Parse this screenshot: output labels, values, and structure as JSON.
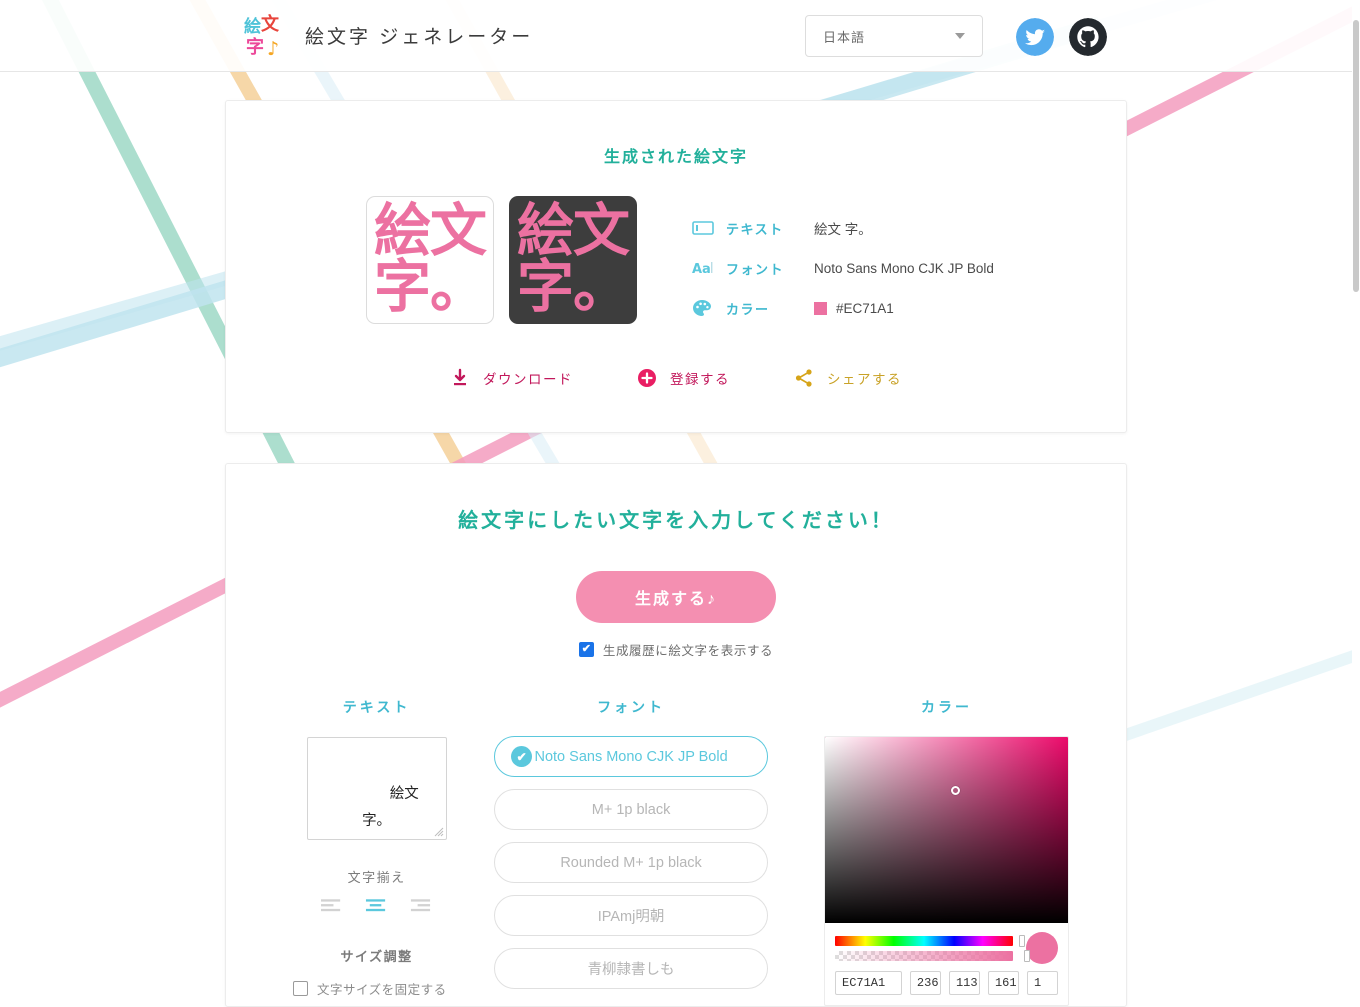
{
  "header": {
    "logo_name": "emoji-gen-logo",
    "title": "絵文字 ジェネレーター",
    "language": {
      "value": "日本語",
      "caret": "chevron-down-icon"
    },
    "social": [
      {
        "name": "twitter",
        "color": "#55ACEE"
      },
      {
        "name": "github",
        "color": "#24292E"
      }
    ]
  },
  "result": {
    "title": "生成された絵文字",
    "preview_text": "絵文\n字。",
    "preview_color": "#EC71A1",
    "dark_bg": "#3D3D3D",
    "meta": [
      {
        "icon": "text-field-icon",
        "label": "テキスト",
        "value": "絵文 字。"
      },
      {
        "icon": "font-aa-icon",
        "label": "フォント",
        "value": "Noto Sans Mono CJK JP Bold"
      },
      {
        "icon": "palette-icon",
        "label": "カラー",
        "value": "#EC71A1",
        "swatch": "#EC71A1"
      }
    ],
    "actions": [
      {
        "icon": "download-icon",
        "label": "ダウンロード",
        "color": "#C2185B"
      },
      {
        "icon": "plus-circle-icon",
        "label": "登録する",
        "color": "#C2185B"
      },
      {
        "icon": "share-icon",
        "label": "シェアする",
        "color": "#C9A227"
      }
    ]
  },
  "input": {
    "title": "絵文字にしたい文字を入力してください！",
    "generate_label": "生成する♪",
    "history_checkbox": {
      "label": "生成履歴に絵文字を表示する",
      "checked": true
    },
    "text_column": {
      "heading": "テキスト",
      "textarea_value": "絵文\n字。",
      "align_heading": "文字揃え",
      "align_options": [
        "left",
        "center",
        "right"
      ],
      "align_selected": "center",
      "size_heading": "サイズ調整",
      "fix_size_label": "文字サイズを固定する",
      "fix_size_checked": false
    },
    "font_column": {
      "heading": "フォント",
      "items": [
        {
          "label": "Noto Sans Mono CJK JP Bold",
          "selected": true
        },
        {
          "label": "M+ 1p black",
          "selected": false
        },
        {
          "label": "Rounded M+ 1p black",
          "selected": false
        },
        {
          "label": "IPAmj明朝",
          "selected": false
        },
        {
          "label": "青柳隷書しも",
          "selected": false
        }
      ]
    },
    "color_column": {
      "heading": "カラー",
      "hex": "EC71A1",
      "r": "236",
      "g": "113",
      "b": "161",
      "a": "1",
      "swatch": "#EC71A1"
    }
  }
}
